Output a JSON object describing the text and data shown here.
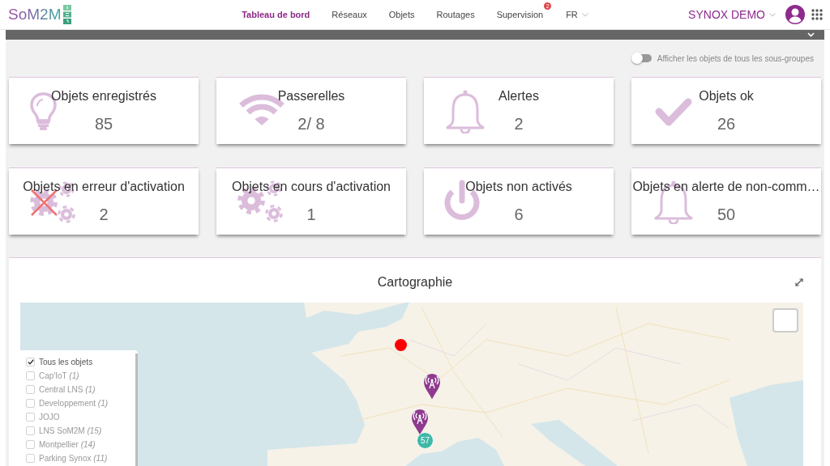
{
  "header": {
    "logo": "SoM2M",
    "nav": [
      {
        "label": "Tableau de bord",
        "selected": true
      },
      {
        "label": "Réseaux",
        "selected": false
      },
      {
        "label": "Objets",
        "selected": false
      },
      {
        "label": "Routages",
        "selected": false
      },
      {
        "label": "Supervision",
        "selected": false,
        "badge": "2"
      }
    ],
    "language": "FR",
    "account": "SYNOX DEMO"
  },
  "subgroups_toggle": {
    "label": "Afficher les objets de tous les sous-groupes",
    "on": false
  },
  "cards": [
    {
      "kind": "registered",
      "title": "Objets enregistrés",
      "value": "85"
    },
    {
      "kind": "gateways",
      "title": "Passerelles",
      "value": "2/ 8"
    },
    {
      "kind": "alerts",
      "title": "Alertes",
      "value": "2"
    },
    {
      "kind": "ok",
      "title": "Objets ok",
      "value": "26"
    },
    {
      "kind": "error",
      "title": "Objets en erreur d'activation",
      "value": "2"
    },
    {
      "kind": "pending",
      "title": "Objets en cours d'activation",
      "value": "1"
    },
    {
      "kind": "inactive",
      "title": "Objets non activés",
      "value": "6"
    },
    {
      "kind": "silent",
      "title": "Objets en alerte de non-comm…",
      "value": "50"
    }
  ],
  "map_panel": {
    "title": "Cartographie",
    "legend": [
      {
        "label": "Tous les objets",
        "checked": true
      },
      {
        "label": "Cap'IoT *(1)*",
        "checked": false
      },
      {
        "label": "Central LNS *(1)*",
        "checked": false
      },
      {
        "label": "Developpement *(1)*",
        "checked": false
      },
      {
        "label": "JOJO",
        "checked": false
      },
      {
        "label": "LNS SoM2M *(15)*",
        "checked": false
      },
      {
        "label": "Montpellier *(14)*",
        "checked": false
      },
      {
        "label": "Parking Synox *(11)*",
        "checked": false
      }
    ],
    "markers": [
      {
        "kind": "alert"
      },
      {
        "kind": "gateway"
      },
      {
        "kind": "gateway"
      }
    ],
    "cluster": {
      "count": "57"
    }
  }
}
